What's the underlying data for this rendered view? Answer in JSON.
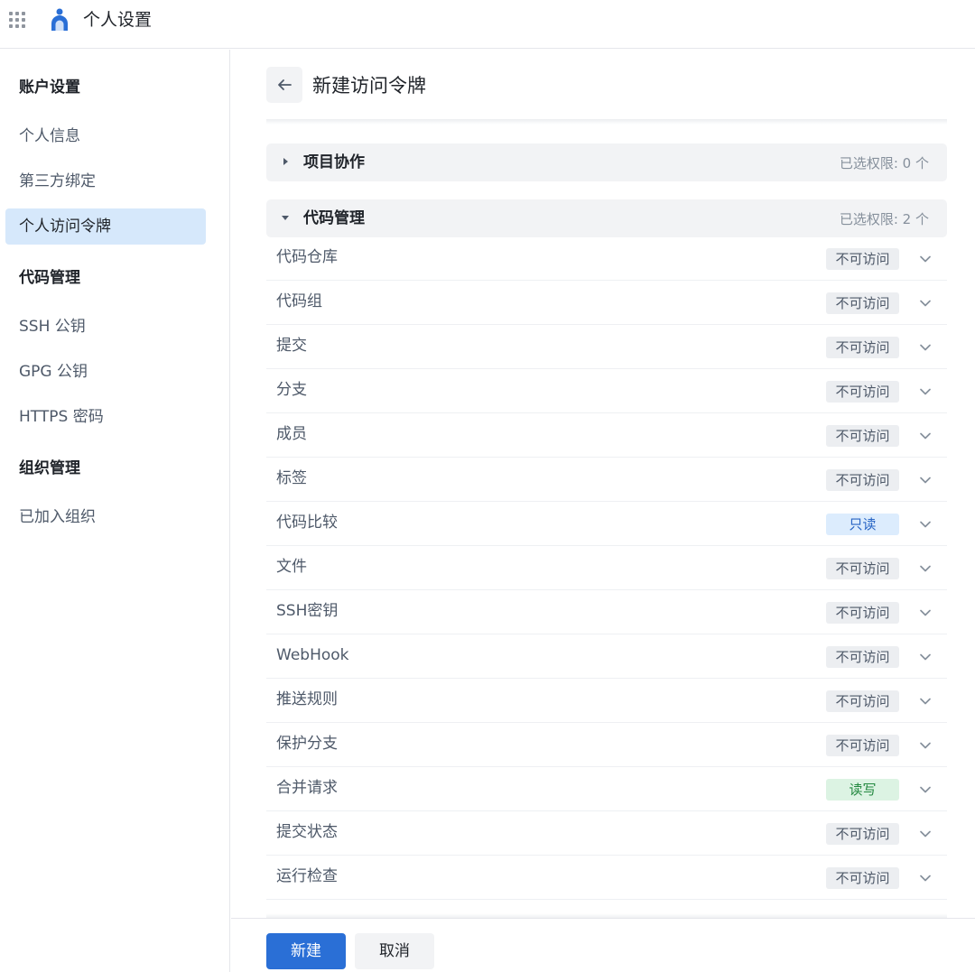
{
  "header": {
    "app_title": "个人设置",
    "menu_icon": "grid-menu-icon",
    "logo_icon": "app-logo-icon"
  },
  "sidebar": {
    "groups": [
      {
        "title": "账户设置",
        "items": [
          "个人信息",
          "第三方绑定",
          "个人访问令牌"
        ]
      },
      {
        "title": "代码管理",
        "items": [
          "SSH 公钥",
          "GPG 公钥",
          "HTTPS 密码"
        ]
      },
      {
        "title": "组织管理",
        "items": [
          "已加入组织"
        ]
      }
    ],
    "active_item": "个人访问令牌"
  },
  "main": {
    "title": "新建访问令牌",
    "back_icon": "arrow-left-icon",
    "sections": [
      {
        "name": "项目协作",
        "count": "已选权限: 0 个",
        "expanded": false
      },
      {
        "name": "代码管理",
        "count": "已选权限: 2 个",
        "expanded": true
      }
    ],
    "permissions": [
      {
        "label": "代码仓库",
        "access": "不可访问",
        "level": "none"
      },
      {
        "label": "代码组",
        "access": "不可访问",
        "level": "none"
      },
      {
        "label": "提交",
        "access": "不可访问",
        "level": "none"
      },
      {
        "label": "分支",
        "access": "不可访问",
        "level": "none"
      },
      {
        "label": "成员",
        "access": "不可访问",
        "level": "none"
      },
      {
        "label": "标签",
        "access": "不可访问",
        "level": "none"
      },
      {
        "label": "代码比较",
        "access": "只读",
        "level": "read"
      },
      {
        "label": "文件",
        "access": "不可访问",
        "level": "none"
      },
      {
        "label": "SSH密钥",
        "access": "不可访问",
        "level": "none"
      },
      {
        "label": "WebHook",
        "access": "不可访问",
        "level": "none"
      },
      {
        "label": "推送规则",
        "access": "不可访问",
        "level": "none"
      },
      {
        "label": "保护分支",
        "access": "不可访问",
        "level": "none"
      },
      {
        "label": "合并请求",
        "access": "读写",
        "level": "write"
      },
      {
        "label": "提交状态",
        "access": "不可访问",
        "level": "none"
      },
      {
        "label": "运行检查",
        "access": "不可访问",
        "level": "none"
      }
    ]
  },
  "footer": {
    "create_label": "新建",
    "cancel_label": "取消"
  },
  "colors": {
    "primary": "#2a6fd6",
    "active_nav_bg": "#d6e8fb",
    "badge_none_bg": "#eceef1",
    "badge_read_bg": "#dcecfd",
    "badge_write_bg": "#dcf3e3"
  }
}
